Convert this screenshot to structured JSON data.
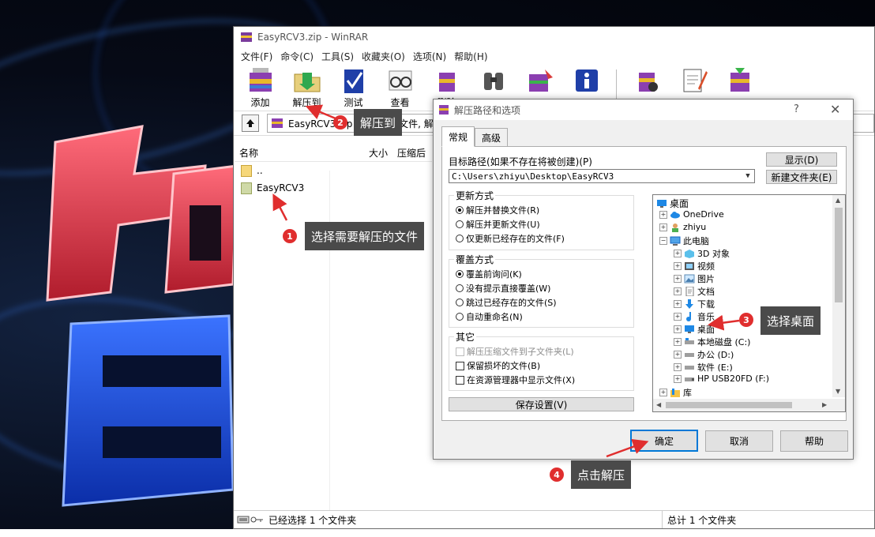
{
  "winrar": {
    "title": "EasyRCV3.zip - WinRAR",
    "menu": [
      "文件(F)",
      "命令(C)",
      "工具(S)",
      "收藏夹(O)",
      "选项(N)",
      "帮助(H)"
    ],
    "toolbar": [
      "添加",
      "解压到",
      "测试",
      "查看",
      "删除"
    ],
    "address": "EasyRCV3.zip - ZIP 压缩文件, 解",
    "columns": {
      "name": "名称",
      "size": "大小",
      "packed": "压缩后"
    },
    "files": [
      {
        "name": "..",
        "icon": "folder-icon"
      },
      {
        "name": "EasyRCV3",
        "icon": "folder-icon"
      }
    ],
    "status_left": "已经选择 1 个文件夹",
    "status_right": "总计 1 个文件夹"
  },
  "dialog": {
    "title": "解压路径和选项",
    "help": "?",
    "close": "✕",
    "tabs": [
      "常规",
      "高级"
    ],
    "path_label": "目标路径(如果不存在将被创建)(P)",
    "path_value": "C:\\Users\\zhiyu\\Desktop\\EasyRCV3",
    "show_button": "显示(D)",
    "new_folder_button": "新建文件夹(E)",
    "update_mode": {
      "title": "更新方式",
      "options": [
        "解压并替换文件(R)",
        "解压并更新文件(U)",
        "仅更新已经存在的文件(F)"
      ],
      "selected": 0
    },
    "overwrite_mode": {
      "title": "覆盖方式",
      "options": [
        "覆盖前询问(K)",
        "没有提示直接覆盖(W)",
        "跳过已经存在的文件(S)",
        "自动重命名(N)"
      ],
      "selected": 0
    },
    "misc": {
      "title": "其它",
      "options": [
        {
          "label": "解压压缩文件到子文件夹(L)",
          "disabled": true
        },
        {
          "label": "保留损坏的文件(B)",
          "disabled": false
        },
        {
          "label": "在资源管理器中显示文件(X)",
          "disabled": false
        }
      ]
    },
    "save_button": "保存设置(V)",
    "tree": [
      {
        "label": "桌面",
        "icon": "desktop-icon"
      },
      {
        "label": "OneDrive",
        "icon": "cloud-icon"
      },
      {
        "label": "zhiyu",
        "icon": "user-icon"
      },
      {
        "label": "此电脑",
        "icon": "computer-icon"
      },
      {
        "label": "3D 对象",
        "icon": "cube-icon"
      },
      {
        "label": "视频",
        "icon": "video-icon"
      },
      {
        "label": "图片",
        "icon": "picture-icon"
      },
      {
        "label": "文档",
        "icon": "document-icon"
      },
      {
        "label": "下载",
        "icon": "download-icon"
      },
      {
        "label": "音乐",
        "icon": "music-icon"
      },
      {
        "label": "桌面",
        "icon": "desktop-icon"
      },
      {
        "label": "本地磁盘 (C:)",
        "icon": "drive-icon"
      },
      {
        "label": "办公 (D:)",
        "icon": "drive-icon"
      },
      {
        "label": "软件 (E:)",
        "icon": "drive-icon"
      },
      {
        "label": "HP USB20FD (F:)",
        "icon": "usb-icon"
      },
      {
        "label": "库",
        "icon": "library-icon"
      }
    ],
    "ok_button": "确定",
    "cancel_button": "取消",
    "help_button": "帮助"
  },
  "callouts": [
    {
      "num": "1",
      "text": "选择需要解压的文件"
    },
    {
      "num": "2",
      "text": "解压到"
    },
    {
      "num": "3",
      "text": "选择桌面"
    },
    {
      "num": "4",
      "text": "点击解压"
    }
  ],
  "colors": {
    "callout_red": "#e02e2e",
    "tooltip_bg": "#4a4a4a",
    "accent_blue": "#0078d7"
  }
}
